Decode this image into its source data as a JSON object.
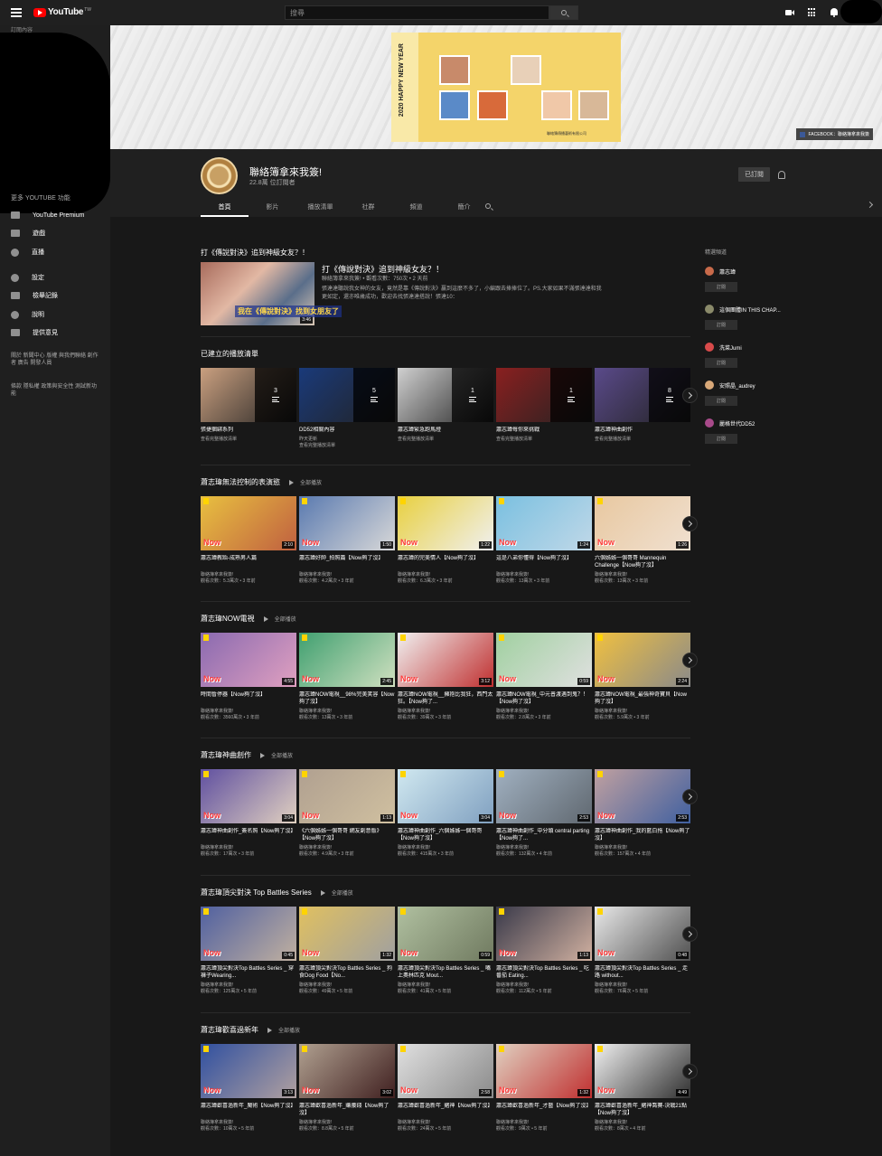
{
  "topbar": {
    "logo_text": "YouTube",
    "logo_region": "TW",
    "search_placeholder": "搜尋"
  },
  "sidebar": {
    "subscriptions_heading": "訂閱內容",
    "more_heading": "更多 YOUTUBE 功能",
    "items": [
      {
        "label": "YouTube Premium",
        "icon": "youtube-premium-icon"
      },
      {
        "label": "遊戲",
        "icon": "gaming-icon"
      },
      {
        "label": "直播",
        "icon": "live-icon"
      },
      {
        "label": "設定",
        "icon": "settings-gear-icon"
      },
      {
        "label": "檢舉記錄",
        "icon": "flag-icon"
      },
      {
        "label": "說明",
        "icon": "help-icon"
      },
      {
        "label": "提供意見",
        "icon": "feedback-icon"
      }
    ],
    "footer1": "關於 新聞中心 版權 與我們聯絡 創作者 廣告 開發人員",
    "footer2": "條款 隱私權 政策與安全性 測試新功能"
  },
  "banner": {
    "poster_year": "2020 HAPPY NEW YEAR",
    "poster_caption": "聯絡簿傳播藝術有限公司",
    "fb_label": "FACEBOOK：聯絡簿拿來我簽"
  },
  "channel": {
    "name": "聯絡簿拿來我簽!",
    "subscribers": "22.8萬 位訂閱者",
    "subscribe_label": "已訂閱",
    "tabs": [
      "首頁",
      "影片",
      "播放清單",
      "社群",
      "頻道",
      "簡介"
    ]
  },
  "featured": {
    "section": "打《傳說對決》追到神級女友？！",
    "title": "打《傳說對決》追到神級女友？！",
    "meta": "聯絡簿拿來我簽! • 觀看次數：750次 • 2 天前",
    "desc": "張達達聽說我女神的女友，竟然是靠《傳說對決》贏到這麼不多了，小編跟去捧捧位了。PS.大家如果不滿張達達和我更如定，還亦唯歲成功，歡迎去找張達達搭說！張達10：",
    "thumb_caption": "我在《傳說對決》找到女朋友了",
    "duration": "3:46"
  },
  "playlists": {
    "section": "已建立的播放清單",
    "items": [
      {
        "title": "張捷捆綁系列",
        "meta1": "查看完整播放清單",
        "meta2": "",
        "count": "3"
      },
      {
        "title": "DD52相關內容",
        "meta1": "昨天更新",
        "meta2": "查看完整播放清單",
        "count": "5"
      },
      {
        "title": "蕭志瑋緊急跑馬燈",
        "meta1": "查看完整播放清單",
        "meta2": "",
        "count": "1"
      },
      {
        "title": "蕭志瑋每你來挑戰",
        "meta1": "查看完整播放清單",
        "meta2": "",
        "count": "1"
      },
      {
        "title": "蕭志瑋神曲創作",
        "meta1": "查看完整播放清單",
        "meta2": "",
        "count": "8"
      }
    ]
  },
  "play_all": "全部播放",
  "shelves": [
    {
      "title": "蕭志瑋無法控制的表演慾",
      "videos": [
        {
          "title": "蕭志瑋教跆-成熟男人篇",
          "channel": "聯絡簿拿來我簽!",
          "meta": "觀看次數：5.3萬次 • 3 年前",
          "dur": "2:10"
        },
        {
          "title": "蕭志瑋好帥_拍照篇【Now夠了沒】",
          "channel": "聯絡簿拿來我簽!",
          "meta": "觀看次數：4.2萬次 • 3 年前",
          "dur": "1:50"
        },
        {
          "title": "蕭志瑋的完美情人【Now夠了沒】",
          "channel": "聯絡簿拿來我簽!",
          "meta": "觀看次數：6.3萬次 • 3 年前",
          "dur": "1:22"
        },
        {
          "title": "這是八弟你懂得【Now夠了沒】",
          "channel": "聯絡簿拿來我簽!",
          "meta": "觀看次數：13萬次 • 3 年前",
          "dur": "1:24"
        },
        {
          "title": "六個姊姊一個哥哥 Mannequin Challenge【Now夠了沒】",
          "channel": "聯絡簿拿來我簽!",
          "meta": "觀看次數：13萬次 • 3 年前",
          "dur": "1:26"
        }
      ]
    },
    {
      "title": "蕭志瑋NOW電視",
      "videos": [
        {
          "title": "時間暫停器【Now夠了沒】",
          "channel": "聯絡簿拿來我簽!",
          "meta": "觀看次數：3560萬次 • 3 年前",
          "dur": "4:55"
        },
        {
          "title": "蕭志瑋NOW電視__98%完美笑容【Now夠了沒】",
          "channel": "聯絡簿拿來我簽!",
          "meta": "觀看次數：13萬次 • 3 年前",
          "dur": "2:45"
        },
        {
          "title": "蕭志瑋NOW電視__擁抱比我狂，西門太狂。【Now夠了...",
          "channel": "聯絡簿拿來我簽!",
          "meta": "觀看次數：39萬次 • 3 年前",
          "dur": "3:12"
        },
        {
          "title": "蕭志瑋NOW電視_中元普渡遇到鬼？！【Now夠了沒】",
          "channel": "聯絡簿拿來我簽!",
          "meta": "觀看次數：2.8萬次 • 3 年前",
          "dur": "0:59"
        },
        {
          "title": "蕭志瑋NOW電視_最強神奇寶貝【Now夠了沒】",
          "channel": "聯絡簿拿來我簽!",
          "meta": "觀看次數：5.9萬次 • 3 年前",
          "dur": "2:24"
        }
      ]
    },
    {
      "title": "蕭志瑋神曲創作",
      "videos": [
        {
          "title": "蕭志瑋神曲創作_簽名照【Now夠了沒】",
          "channel": "聯絡簿拿來我簽!",
          "meta": "觀看次數：17萬次 • 3 年前",
          "dur": "3:04"
        },
        {
          "title": "《六個姊姊一個哥哥 網友創意版》【Now夠了沒】",
          "channel": "聯絡簿拿來我簽!",
          "meta": "觀看次數：4.9萬次 • 3 年前",
          "dur": "1:13"
        },
        {
          "title": "蕭志瑋神曲創作_六個姊姊一個哥哥【Now夠了沒】",
          "channel": "聯絡簿拿來我簽!",
          "meta": "觀看次數：415萬次 • 3 年前",
          "dur": "3:04"
        },
        {
          "title": "蕭志瑋神曲創作_中分頭 central parting【Now夠了...",
          "channel": "聯絡簿拿來我簽!",
          "meta": "觀看次數：132萬次 • 4 年前",
          "dur": "2:53"
        },
        {
          "title": "蕭志瑋神曲創作_我的藍白拖【Now夠了沒】",
          "channel": "聯絡簿拿來我簽!",
          "meta": "觀看次數：157萬次 • 4 年前",
          "dur": "2:53"
        }
      ]
    },
    {
      "title": "蕭志瑋頂尖對決 Top Battles Series",
      "videos": [
        {
          "title": "蕭志瑋頂尖對決Top Battles Series _ 穿褲子Wearing...",
          "channel": "聯絡簿拿來我簽!",
          "meta": "觀看次數：125萬次 • 5 年前",
          "dur": "0:45"
        },
        {
          "title": "蕭志瑋頂尖對決Top Battles Series _ 狗食Dog Food【No...",
          "channel": "聯絡簿拿來我簽!",
          "meta": "觀看次數：49萬次 • 5 年前",
          "dur": "1:32"
        },
        {
          "title": "蕭志瑋頂尖對決Top Battles Series _ 嘴上奧林匹克 Mout...",
          "channel": "聯絡簿拿來我簽!",
          "meta": "觀看次數：41萬次 • 5 年前",
          "dur": "0:59"
        },
        {
          "title": "蕭志瑋頂尖對決Top Battles Series _ 吃番茄 Eating...",
          "channel": "聯絡簿拿來我簽!",
          "meta": "觀看次數：112萬次 • 5 年前",
          "dur": "1:13"
        },
        {
          "title": "蕭志瑋頂尖對決Top Battles Series _ 走路 without...",
          "channel": "聯絡簿拿來我簽!",
          "meta": "觀看次數：76萬次 • 5 年前",
          "dur": "0:48"
        }
      ]
    },
    {
      "title": "蕭志瑋歡喜過新年",
      "videos": [
        {
          "title": "蕭志瑋歡喜過新年_魔術【Now夠了沒】",
          "channel": "聯絡簿拿來我簽!",
          "meta": "觀看次數：10萬次 • 5 年前",
          "dur": "3:13"
        },
        {
          "title": "蕭志瑋歡喜過新年_賺腰錢【Now夠了沒】",
          "channel": "聯絡簿拿來我簽!",
          "meta": "觀看次數：8.8萬次 • 5 年前",
          "dur": "3:02"
        },
        {
          "title": "蕭志瑋歡喜過新年_賭神【Now夠了沒】",
          "channel": "聯絡簿拿來我簽!",
          "meta": "觀看次數：24萬次 • 5 年前",
          "dur": "2:58"
        },
        {
          "title": "蕭志瑋歡喜過新年_才藝【Now夠了沒】",
          "channel": "聯絡簿拿來我簽!",
          "meta": "觀看次數：9萬次 • 5 年前",
          "dur": "1:32"
        },
        {
          "title": "蕭志瑋歡喜過新年_賭神喬賽-決戰21點【Now夠了沒】",
          "channel": "聯絡簿拿來我簽!",
          "meta": "觀看次數：8萬次 • 4 年前",
          "dur": "4:49"
        }
      ]
    }
  ],
  "related": {
    "title": "精選頻道",
    "subscribe_label": "訂閱",
    "channels": [
      {
        "name": "蕭志瑋",
        "color": "#c86a4a"
      },
      {
        "name": "這個團體IN THIS CHAP...",
        "color": "#8a8a6a"
      },
      {
        "name": "洗菜Jumi",
        "color": "#d84a4a"
      },
      {
        "name": "安照晶_audrey",
        "color": "#d8a878"
      },
      {
        "name": "麗格世代DD52",
        "color": "#a84a8a"
      }
    ]
  }
}
